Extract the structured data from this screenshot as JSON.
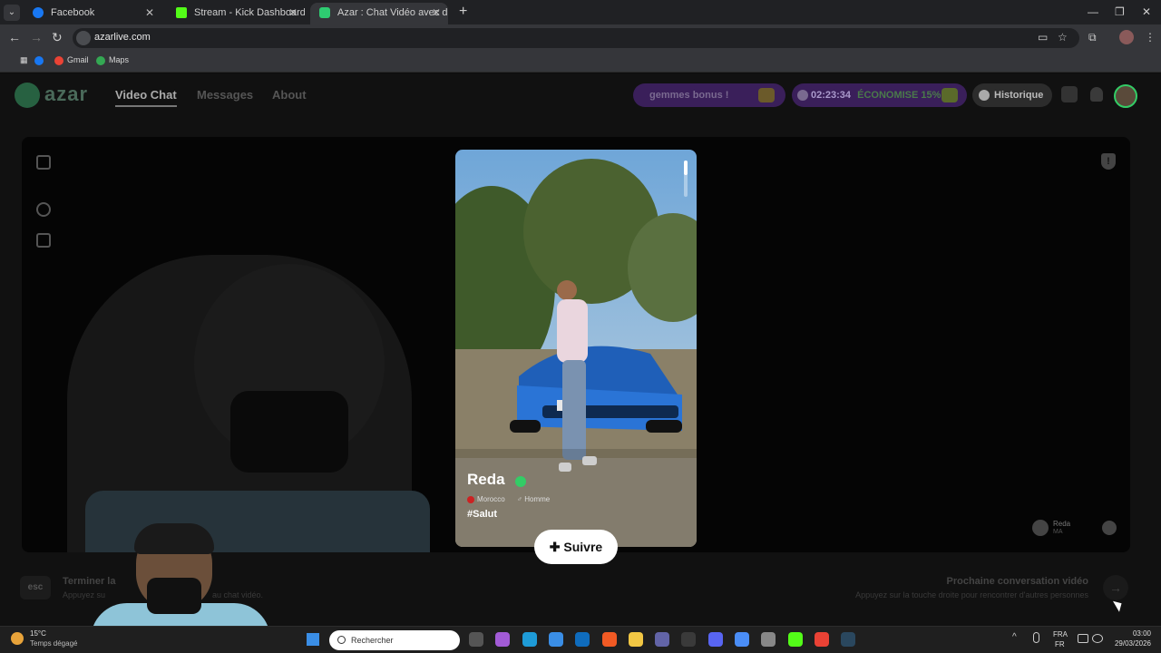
{
  "browser": {
    "tabs": [
      {
        "label": "Facebook",
        "favicon_color": "#1877f2"
      },
      {
        "label": "Stream - Kick Dashboard",
        "favicon_color": "#53fc18"
      },
      {
        "label": "Azar : Chat Vidéo avec de n",
        "favicon_color": "#2ecc71"
      }
    ],
    "tab_close": "✕",
    "new_tab": "+",
    "url": "azarlive.com",
    "bookmarks": [
      {
        "label": "",
        "color": "#1877f2"
      },
      {
        "label": "Gmail",
        "color": "#ea4335"
      },
      {
        "label": "Maps",
        "color": "#34a853"
      }
    ],
    "window_controls": {
      "minimize": "—",
      "maximize": "❐",
      "close": "✕"
    }
  },
  "app": {
    "logo_text": "azar",
    "nav": {
      "video_chat": "Video Chat",
      "messages": "Messages",
      "about": "About"
    },
    "promo_bonus": "gemmes bonus !",
    "timer": "02:23:34",
    "discount": "ÉCONOMISE 15%",
    "history": "Historique",
    "profile_card": {
      "name": "Reda",
      "country": "Morocco",
      "gender": "♂ Homme",
      "tag": "#Salut"
    },
    "follow_label": "Suivre",
    "follow_icon": "✚",
    "peer": {
      "name": "Reda",
      "country_code": "MA"
    },
    "esc_key": "esc",
    "end_title": "Terminer la",
    "end_sub_a": "Appuyez su",
    "end_sub_b": "au chat vidéo.",
    "next_title": "Prochaine conversation vidéo",
    "next_sub": "Appuyez sur la touche droite pour rencontrer d'autres personnes",
    "next_arrow": "→",
    "report_icon": "!"
  },
  "taskbar": {
    "temperature": "15°C",
    "weather": "Temps dégagé",
    "search_placeholder": "Rechercher",
    "lang_top": "FRA",
    "lang_bottom": "FR",
    "time": "03:00",
    "date": "29/03/2026",
    "tray_up": "^",
    "apps": [
      {
        "name": "task-view",
        "color": "#555"
      },
      {
        "name": "copilot",
        "color": "#a25bd6"
      },
      {
        "name": "edge",
        "color": "#1e9bd7"
      },
      {
        "name": "store",
        "color": "#3a8ee6"
      },
      {
        "name": "outlook",
        "color": "#0f6cbd"
      },
      {
        "name": "brave",
        "color": "#f15a24"
      },
      {
        "name": "explorer",
        "color": "#f2c744"
      },
      {
        "name": "teams",
        "color": "#6264a7"
      },
      {
        "name": "xbox",
        "color": "#3a3a3a"
      },
      {
        "name": "discord",
        "color": "#5865f2"
      },
      {
        "name": "chrome",
        "color": "#4a8df6"
      },
      {
        "name": "chrome-2",
        "color": "#888"
      },
      {
        "name": "app-green",
        "color": "#53fc18"
      },
      {
        "name": "chrome-3",
        "color": "#e94235"
      },
      {
        "name": "steam",
        "color": "#2a475e"
      }
    ]
  }
}
